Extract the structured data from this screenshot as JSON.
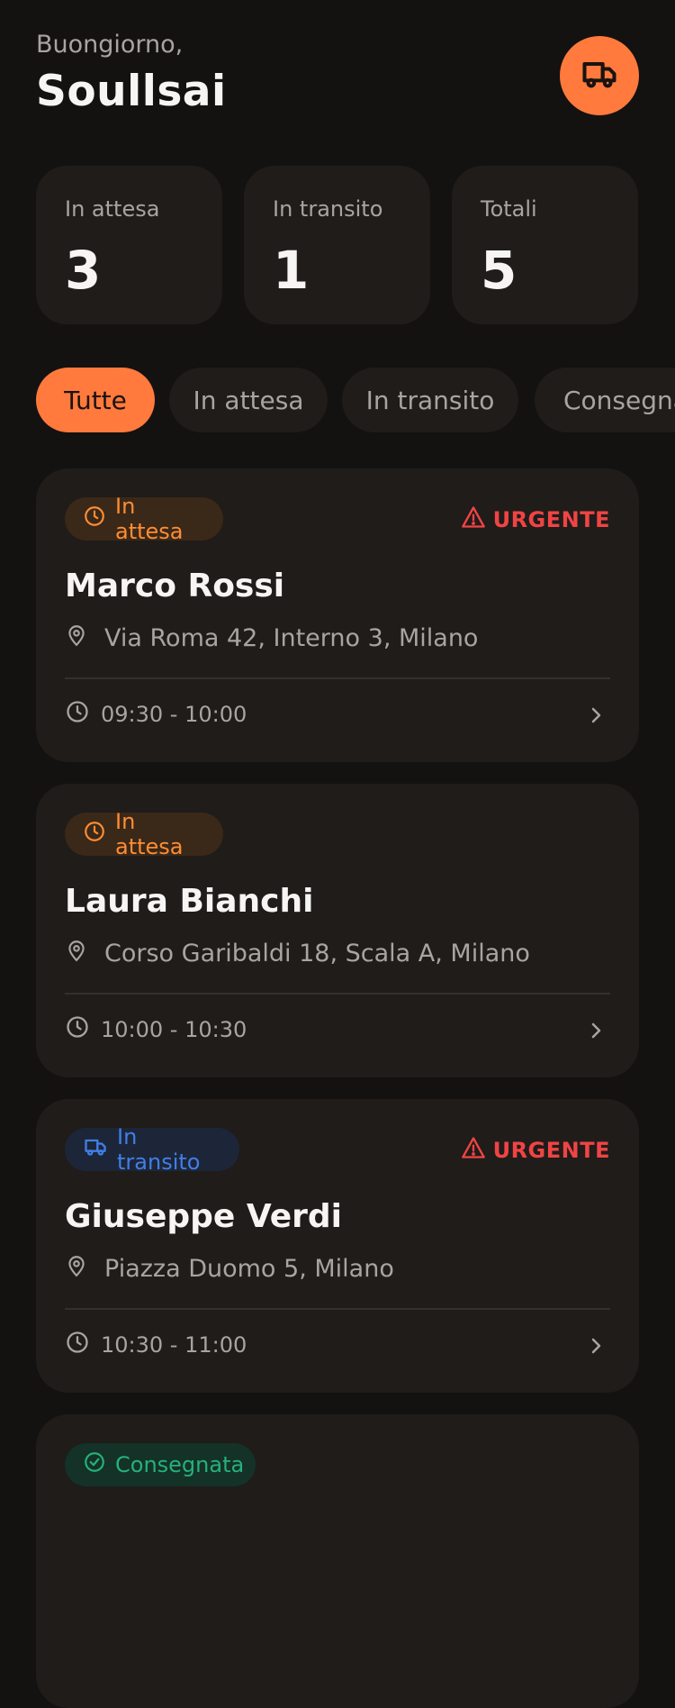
{
  "header": {
    "greeting": "Buongiorno,",
    "username": "Soullsai",
    "action_icon": "truck-icon"
  },
  "stats": [
    {
      "label": "In attesa",
      "value": "3"
    },
    {
      "label": "In transito",
      "value": "1"
    },
    {
      "label": "Totali",
      "value": "5"
    }
  ],
  "filters": [
    "Tutte",
    "In attesa",
    "In transito",
    "Consegnata"
  ],
  "active_filter": "Tutte",
  "deliveries": [
    {
      "status": "In attesa",
      "status_icon": "clock-icon",
      "urgent_label": "URGENTE",
      "name": "Marco Rossi",
      "address": "Via Roma 42, Interno 3, Milano",
      "time": "09:30 - 10:00"
    },
    {
      "status": "In attesa",
      "status_icon": "clock-icon",
      "urgent_label": "",
      "name": "Laura Bianchi",
      "address": "Corso Garibaldi 18, Scala A, Milano",
      "time": "10:00 - 10:30"
    },
    {
      "status": "In transito",
      "status_icon": "truck-icon",
      "urgent_label": "URGENTE",
      "name": "Giuseppe Verdi",
      "address": "Piazza Duomo 5, Milano",
      "time": "10:30 - 11:00"
    },
    {
      "status": "Consegnata",
      "status_icon": "check-circle-icon"
    }
  ],
  "colors": {
    "background": "#131211",
    "card": "#1f1c1a",
    "accent": "#ff7a3c",
    "urgent": "#f04444",
    "pending": "#ff8d33",
    "transit": "#3f7fe8",
    "delivered": "#26b07c"
  }
}
